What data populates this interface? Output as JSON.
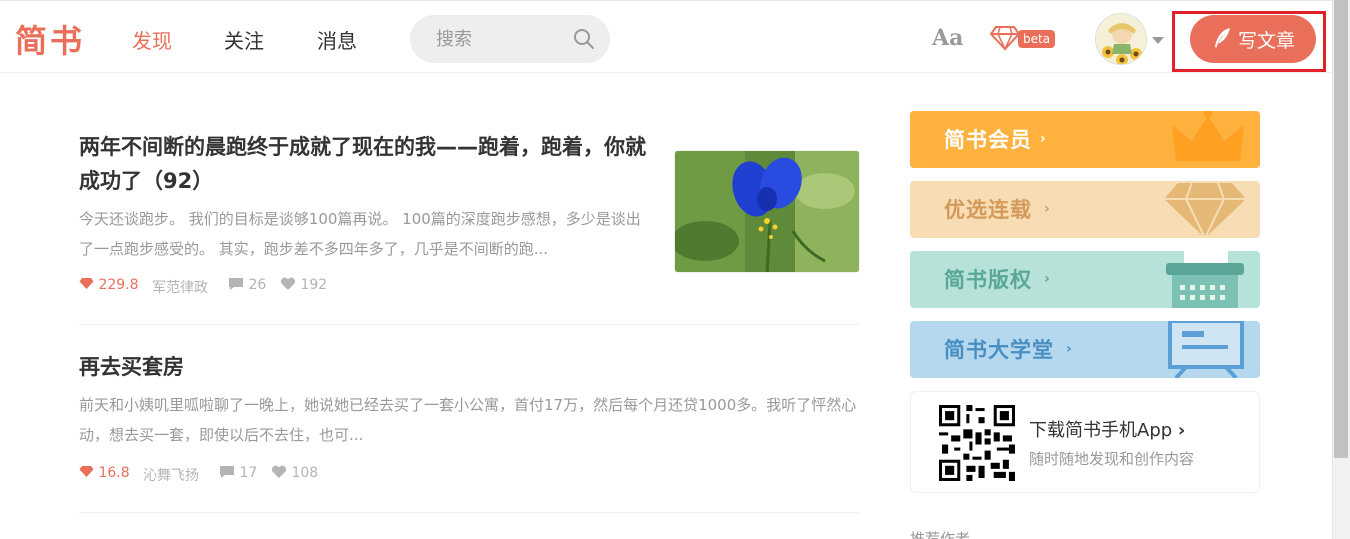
{
  "header": {
    "logo": "简书",
    "nav": [
      {
        "label": "发现",
        "active": true
      },
      {
        "label": "关注",
        "active": false
      },
      {
        "label": "消息",
        "active": false
      }
    ],
    "search_placeholder": "搜索",
    "font_toggle": "Aa",
    "beta_badge": "beta",
    "write_button": "写文章"
  },
  "articles": [
    {
      "title": "两年不间断的晨跑终于成就了现在的我——跑着，跑着，你就成功了（92）",
      "abstract": "今天还谈跑步。 我们的目标是谈够100篇再说。 100篇的深度跑步感想，多少是谈出了一点跑步感受的。 其实，跑步差不多四年多了，几乎是不间断的跑...",
      "score": "229.8",
      "author": "军范律政",
      "comments": "26",
      "likes": "192",
      "has_image": true
    },
    {
      "title": "再去买套房",
      "abstract": "前天和小姨叽里呱啦聊了一晚上，她说她已经去买了一套小公寓，首付17万，然后每个月还贷1000多。我听了怦然心动，想去买一套，即使以后不去住，也可...",
      "score": "16.8",
      "author": "沁舞飞扬",
      "comments": "17",
      "likes": "108",
      "has_image": false
    }
  ],
  "sidebar": {
    "banners": [
      {
        "label": "简书会员",
        "color": "#ffb13d",
        "text_color": "#ffffff"
      },
      {
        "label": "优选连载",
        "color": "#f7dcb4",
        "text_color": "#d39a5a"
      },
      {
        "label": "简书版权",
        "color": "#b6e2d9",
        "text_color": "#5aa79a"
      },
      {
        "label": "简书大学堂",
        "color": "#b6d8ef",
        "text_color": "#4a8fc2"
      }
    ],
    "app": {
      "title": "下载简书手机App",
      "subtitle": "随时随地发现和创作内容"
    },
    "recommend_partial": "推荐作者"
  },
  "colors": {
    "brand": "#ea6f5a",
    "highlight_frame": "#e0212a"
  }
}
